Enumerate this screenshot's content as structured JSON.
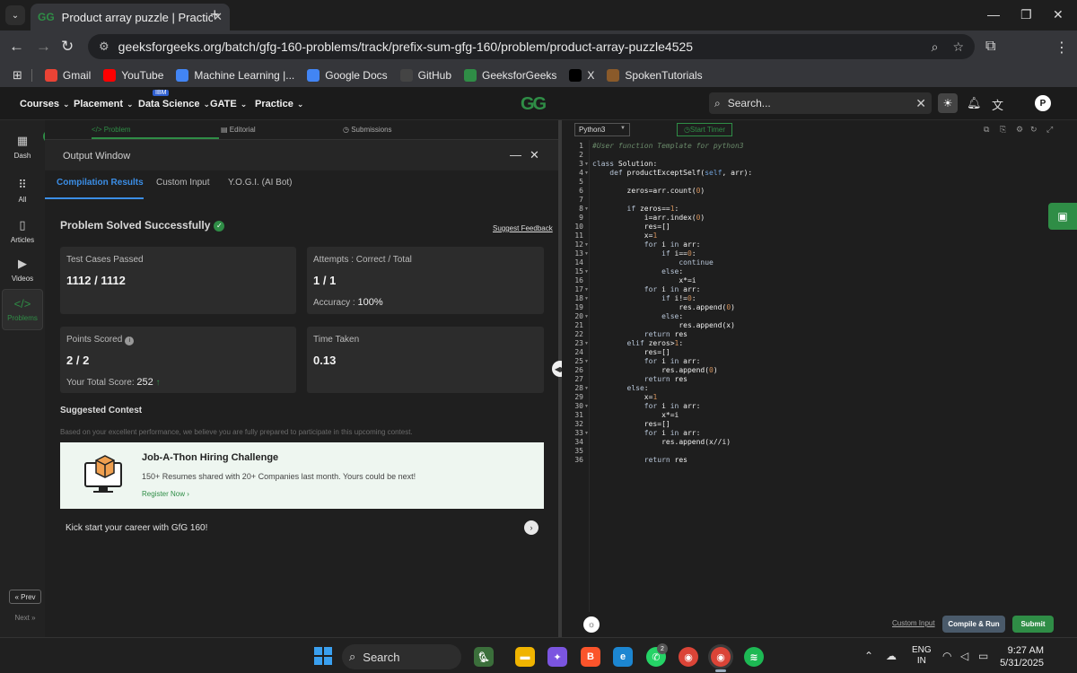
{
  "browser": {
    "tab_title": "Product array puzzle | Practice |",
    "url": "geeksforgeeks.org/batch/gfg-160-problems/track/prefix-sum-gfg-160/problem/product-array-puzzle4525",
    "bookmarks": [
      {
        "label": "Gmail",
        "icon": "gmail-icon",
        "color": "#ea4335"
      },
      {
        "label": "YouTube",
        "icon": "youtube-icon",
        "color": "#ff0000"
      },
      {
        "label": "Machine Learning  |...",
        "icon": "google-icon",
        "color": "#4285f4"
      },
      {
        "label": "Google Docs",
        "icon": "docs-icon",
        "color": "#4285f4"
      },
      {
        "label": "GitHub",
        "icon": "github-icon",
        "color": "#444444"
      },
      {
        "label": "GeeksforGeeks",
        "icon": "gfg-icon",
        "color": "#2f8d46"
      },
      {
        "label": "X",
        "icon": "x-icon",
        "color": "#000000"
      },
      {
        "label": "SpokenTutorials",
        "icon": "spoken-tutorials-icon",
        "color": "#8a5a2a"
      }
    ]
  },
  "site": {
    "nav": [
      {
        "label": "Courses"
      },
      {
        "label": "Placement"
      },
      {
        "label": "Data Science"
      },
      {
        "label": "GATE"
      },
      {
        "label": "Practice"
      }
    ],
    "ibm_badge": "IBM",
    "logo": "GG",
    "search_placeholder": "Search...",
    "avatar_initial": "P"
  },
  "rail": {
    "items": [
      {
        "label": "Dash",
        "icon": "dashboard-icon"
      },
      {
        "label": "All",
        "icon": "grid-icon"
      },
      {
        "label": "Articles",
        "icon": "book-icon"
      },
      {
        "label": "Videos",
        "icon": "video-icon"
      },
      {
        "label": "Problems",
        "icon": "code-icon"
      }
    ],
    "prev": "« Prev",
    "next": "Next »"
  },
  "problem_tabs": {
    "problem": "</> Problem",
    "editorial": "Editorial",
    "submissions": "Submissions"
  },
  "output_window": {
    "title": "Output Window",
    "tabs": [
      "Compilation Results",
      "Custom Input",
      "Y.O.G.I. (AI Bot)"
    ],
    "status": "Problem Solved Successfully",
    "feedback": "Suggest Feedback",
    "test_cases_label": "Test Cases Passed",
    "test_cases_value": "1112 / 1112",
    "attempts_label": "Attempts : Correct / Total",
    "attempts_value": "1 / 1",
    "accuracy_label": "Accuracy :",
    "accuracy_value": "100%",
    "points_label": "Points Scored",
    "points_value": "2 / 2",
    "total_score_label": "Your Total Score:",
    "total_score_value": "252",
    "time_label": "Time Taken",
    "time_value": "0.13",
    "suggested_heading": "Suggested Contest",
    "suggested_text": "Based on your excellent performance, we believe you are fully prepared to participate in this upcoming contest.",
    "contest_title": "Job-A-Thon Hiring Challenge",
    "contest_desc": "150+ Resumes shared with 20+ Companies last month. Yours could be next!",
    "contest_register": "Register Now ›",
    "kickstart": "Kick start your career with GfG 160!"
  },
  "editor": {
    "language": "Python3",
    "timer": "Start Timer",
    "custom_input": "Custom Input",
    "compile": "Compile & Run",
    "submit": "Submit",
    "lines": [
      "#User function Template for python3",
      "",
      "class Solution:",
      "    def productExceptSelf(self, arr):",
      "",
      "        zeros=arr.count(0)",
      "",
      "        if zeros==1:",
      "            i=arr.index(0)",
      "            res=[]",
      "            x=1",
      "            for i in arr:",
      "                if i==0:",
      "                    continue",
      "                else:",
      "                    x*=i",
      "            for i in arr:",
      "                if i!=0:",
      "                    res.append(0)",
      "                else:",
      "                    res.append(x)",
      "            return res",
      "        elif zeros>1:",
      "            res=[]",
      "            for i in arr:",
      "                res.append(0)",
      "            return res",
      "        else:",
      "            x=1",
      "            for i in arr:",
      "                x*=i",
      "            res=[]",
      "            for i in arr:",
      "                res.append(x//i)",
      "",
      "            return res"
    ],
    "fold_lines": [
      3,
      4,
      8,
      12,
      13,
      15,
      17,
      18,
      20,
      23,
      25,
      28,
      30,
      33
    ]
  },
  "taskbar": {
    "search": "Search",
    "whatsapp_badge": "2",
    "lang_line1": "ENG",
    "lang_line2": "IN",
    "time": "9:27 AM",
    "date": "5/31/2025"
  }
}
